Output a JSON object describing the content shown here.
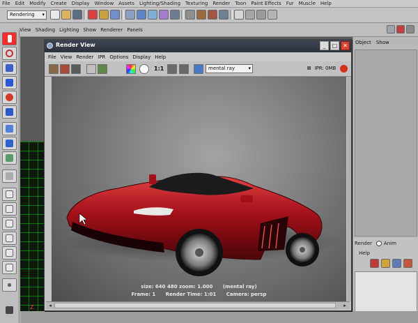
{
  "main_menu": [
    "File",
    "Edit",
    "Modify",
    "Create",
    "Display",
    "Window",
    "Assets",
    "Lighting/Shading",
    "Texturing",
    "Render",
    "Toon",
    "Paint Effects",
    "Fur",
    "Muscle",
    "Help"
  ],
  "mode_dropdown": {
    "value": "Rendering"
  },
  "panel_menu": [
    "View",
    "Shading",
    "Lighting",
    "Show",
    "Renderer",
    "Panels"
  ],
  "render_view": {
    "title": "Render View",
    "menu": [
      "File",
      "View",
      "Render",
      "IPR",
      "Options",
      "Display",
      "Help"
    ],
    "ratio_label": "1:1",
    "renderer": "mental ray",
    "ipr_pause": "II",
    "ipr_text": "IPR: 0MB",
    "info_line1": {
      "size": "size:  640  480  zoom: 1.000",
      "renderer": "(mental ray)"
    },
    "info_line2": {
      "frame": "Frame: 1",
      "render_time": "Render Time: 1:01",
      "camera": "Camera: persp"
    }
  },
  "right_panel": {
    "menu": [
      "Object",
      "Show"
    ],
    "render_label": "Render",
    "anim_label": "Anim",
    "help_label": "Help"
  },
  "viewport": {
    "axis": "Z"
  },
  "colors": {
    "car": "#b0141a",
    "active_tool": "#ff2a2a",
    "titlebar": "#343a46",
    "grid": "#00c800"
  }
}
